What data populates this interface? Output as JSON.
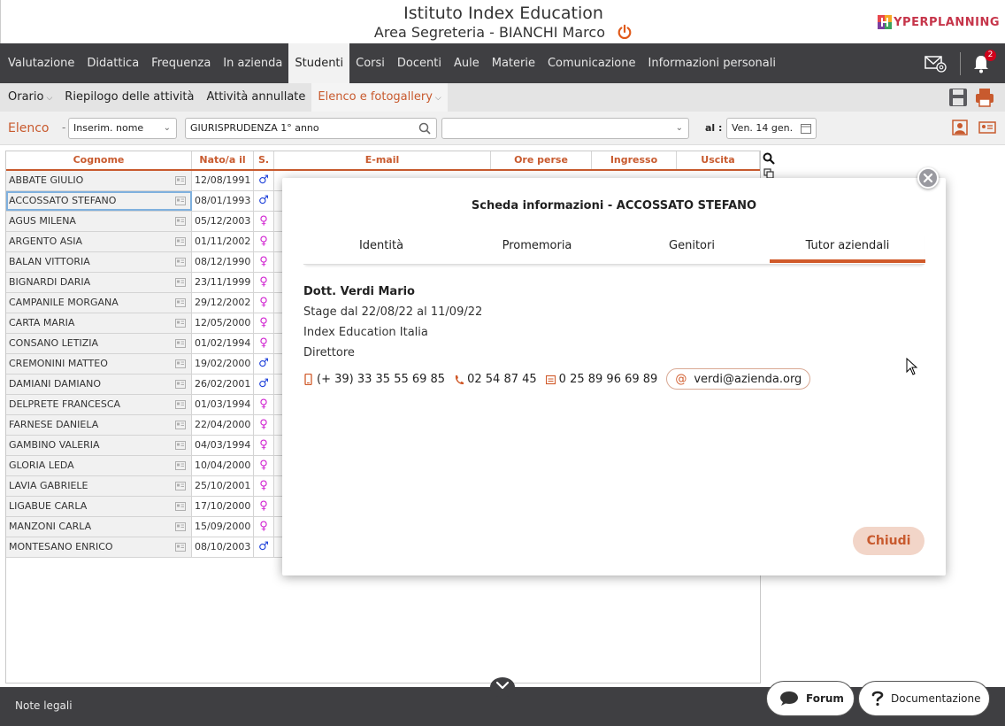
{
  "header": {
    "school": "Istituto Index Education",
    "area": "Area Segreteria - BIANCHI Marco",
    "brand": "YPERPLANNING",
    "notification_count": "2"
  },
  "main_nav": [
    "Valutazione",
    "Didattica",
    "Frequenza",
    "In azienda",
    "Studenti",
    "Corsi",
    "Docenti",
    "Aule",
    "Materie",
    "Comunicazione",
    "Informazioni personali"
  ],
  "main_nav_active": "Studenti",
  "sub_nav": [
    {
      "label": "Orario",
      "dropdown": true
    },
    {
      "label": "Riepilogo delle attività",
      "dropdown": false
    },
    {
      "label": "Attività annullate",
      "dropdown": false
    },
    {
      "label": "Elenco e fotogallery",
      "dropdown": true,
      "active": true
    }
  ],
  "toolbar": {
    "label": "Elenco",
    "dash": "-",
    "filter_select": "Inserim. nome",
    "course_filter": "GIURISPRUDENZA  1° anno",
    "extra_select": "",
    "al_label": "al :",
    "date": "Ven. 14 gen."
  },
  "table": {
    "headers": [
      "Cognome",
      "Nato/a il",
      "S.",
      "E-mail",
      "Ore perse",
      "Ingresso",
      "Uscita"
    ],
    "rows": [
      {
        "name": "ABBATE GIULIO",
        "date": "12/08/1991",
        "sex": "M"
      },
      {
        "name": "ACCOSSATO STEFANO",
        "date": "08/01/1993",
        "sex": "M",
        "selected": true
      },
      {
        "name": "AGUS MILENA",
        "date": "05/12/2003",
        "sex": "F"
      },
      {
        "name": "ARGENTO ASIA",
        "date": "01/11/2002",
        "sex": "F"
      },
      {
        "name": "BALAN VITTORIA",
        "date": "08/12/1990",
        "sex": "F"
      },
      {
        "name": "BIGNARDI DARIA",
        "date": "23/11/1999",
        "sex": "F"
      },
      {
        "name": "CAMPANILE MORGANA",
        "date": "29/12/2002",
        "sex": "F"
      },
      {
        "name": "CARTA MARIA",
        "date": "12/05/2000",
        "sex": "F"
      },
      {
        "name": "CONSANO LETIZIA",
        "date": "01/02/1994",
        "sex": "F"
      },
      {
        "name": "CREMONINI MATTEO",
        "date": "19/02/2000",
        "sex": "M"
      },
      {
        "name": "DAMIANI DAMIANO",
        "date": "26/02/2001",
        "sex": "M"
      },
      {
        "name": "DELPRETE FRANCESCA",
        "date": "01/03/1994",
        "sex": "F"
      },
      {
        "name": "FARNESE DANIELA",
        "date": "22/04/2000",
        "sex": "F"
      },
      {
        "name": "GAMBINO VALERIA",
        "date": "04/03/1994",
        "sex": "F"
      },
      {
        "name": "GLORIA LEDA",
        "date": "10/04/2000",
        "sex": "F"
      },
      {
        "name": "LAVIA GABRIELE",
        "date": "25/10/2001",
        "sex": "F"
      },
      {
        "name": "LIGABUE CARLA",
        "date": "17/10/2000",
        "sex": "F"
      },
      {
        "name": "MANZONI CARLA",
        "date": "15/09/2000",
        "sex": "F"
      },
      {
        "name": "MONTESANO ENRICO",
        "date": "08/10/2003",
        "sex": "M"
      }
    ]
  },
  "modal": {
    "title": "Scheda informazioni - ACCOSSATO STEFANO",
    "tabs": [
      "Identità",
      "Promemoria",
      "Genitori",
      "Tutor aziendali"
    ],
    "active_tab": "Tutor aziendali",
    "tutor": {
      "name": "Dott. Verdi Mario",
      "stage": "Stage dal 22/08/22 al 11/09/22",
      "company": "Index Education Italia",
      "role": "Direttore",
      "mobile": "(+ 39) 33 35 55 69 85",
      "phone": "02 54 87 45",
      "fax": "0 25 89 96 69 89",
      "email": "verdi@azienda.org"
    },
    "close_label": "Chiudi"
  },
  "footer": {
    "legal": "Note legali",
    "forum": "Forum",
    "documentation": "Documentazione"
  },
  "colors": {
    "accent": "#c85a2e",
    "nav_bg": "#3f3f42",
    "male": "#1c3fd9",
    "female": "#d021d0"
  }
}
